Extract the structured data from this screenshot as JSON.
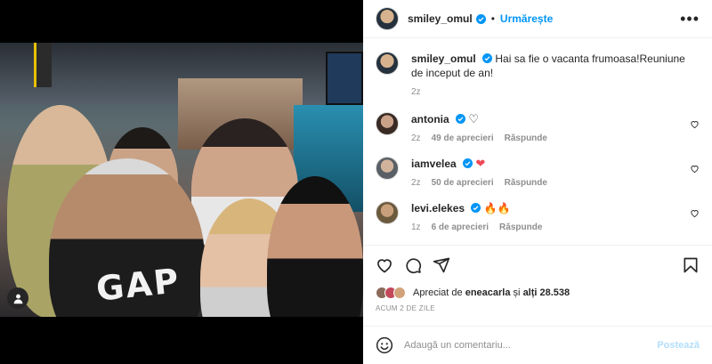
{
  "header": {
    "username": "smiley_omul",
    "dot": "•",
    "follow_label": "Urmărește",
    "more_label": "•••"
  },
  "caption": {
    "username": "smiley_omul",
    "text": "Hai sa fie o vacanta frumoasa!Reuniune de inceput de an!",
    "age": "2z"
  },
  "comments": [
    {
      "username": "antonia",
      "emoji": "♡",
      "age": "2z",
      "likes": "49 de aprecieri",
      "reply": "Răspunde"
    },
    {
      "username": "iamvelea",
      "emoji": "❤",
      "age": "2z",
      "likes": "50 de aprecieri",
      "reply": "Răspunde"
    },
    {
      "username": "levi.elekes",
      "emoji": "🔥🔥",
      "age": "1z",
      "likes": "6 de aprecieri",
      "reply": "Răspunde"
    }
  ],
  "photo": {
    "shirt_text": "GAP"
  },
  "likes": {
    "prefix": "Apreciat de",
    "user": "eneacarla",
    "middle": "și",
    "others": "alți 28.538"
  },
  "timestamp": "ACUM 2 DE ZILE",
  "composer": {
    "placeholder": "Adaugă un comentariu...",
    "post_label": "Postează"
  },
  "colors": {
    "accent": "#0095f6",
    "verified": "#0095f6",
    "heart_red": "#ed4956",
    "post_disabled": "#b2dffc"
  }
}
